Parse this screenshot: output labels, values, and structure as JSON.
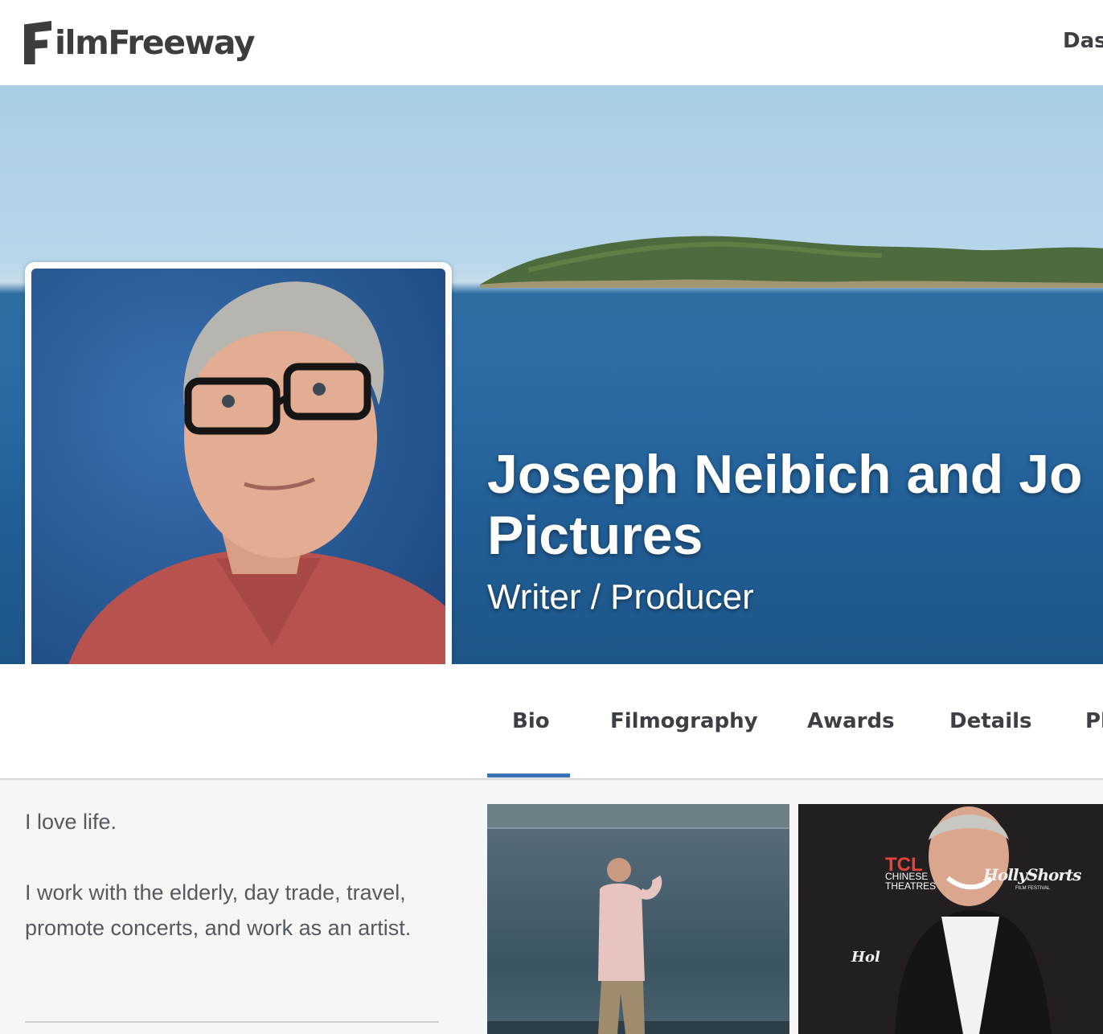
{
  "header": {
    "logo_text": "ilmFreeway",
    "nav_right_label": "Das"
  },
  "hero": {
    "title_line1": "Joseph Neibich and Jo",
    "title_line2": "Pictures",
    "subtitle": "Writer / Producer"
  },
  "tabs": [
    {
      "label": "Bio",
      "active": true
    },
    {
      "label": "Filmography",
      "active": false
    },
    {
      "label": "Awards",
      "active": false
    },
    {
      "label": "Details",
      "active": false
    },
    {
      "label": "Pl",
      "active": false
    }
  ],
  "bio": {
    "paragraph1": "I love life.",
    "paragraph2": "I work with the elderly, day trade, travel, promote concerts, and work as an artist."
  },
  "gallery": {
    "photo2_sign_line1": "TCL",
    "photo2_sign_line2": "CHINESE",
    "photo2_sign_line3": "THEATRES",
    "photo2_logo": "HollyShorts",
    "photo2_logo_sub": "FILM FESTIVAL",
    "photo2_logo_left": "Hol"
  },
  "colors": {
    "accent": "#3b73b9",
    "text": "#3c3f44",
    "background": "#f6f6f6"
  },
  "icons": {
    "logo": "filmfreeway-f-icon"
  }
}
